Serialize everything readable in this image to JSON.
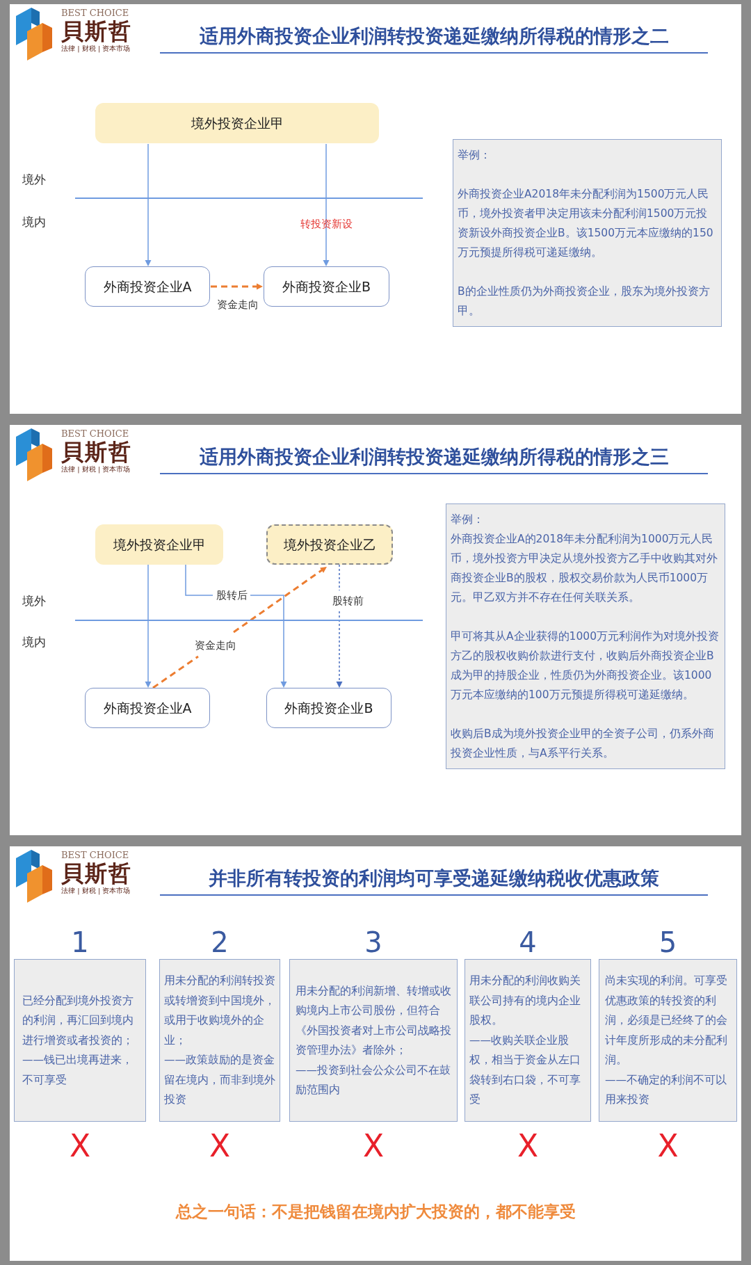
{
  "slides": [
    {
      "kind": "new-investment",
      "logo": {
        "tagline_en": "BEST CHOICE",
        "brand": "貝斯哲",
        "tagline_cn": "法律 | 财税 | 资本市场"
      },
      "title": "适用外商投资企业利润转投资递延缴纳所得税的情形之二",
      "diagram": {
        "nodes": [
          "境外投资企业甲",
          "外商投资企业A",
          "外商投资企业B"
        ],
        "zones": [
          "境外",
          "境内"
        ],
        "invest_label": "转投资新设",
        "flow_label": "资金走向"
      },
      "example": {
        "heading": "举例：",
        "paragraphs": [
          "外商投资企业A2018年未分配利润为1500万元人民币，境外投资者甲决定用该未分配利润1500万元投资新设外商投资企业B。该1500万元本应缴纳的150万元预提所得税可递延缴纳。",
          "B的企业性质仍为外商投资企业，股东为境外投资方甲。"
        ]
      }
    },
    {
      "kind": "acquisition",
      "logo": {
        "tagline_en": "BEST CHOICE",
        "brand": "貝斯哲",
        "tagline_cn": "法律 | 财税 | 资本市场"
      },
      "title": "适用外商投资企业利润转投资递延缴纳所得税的情形之三",
      "diagram": {
        "nodes": [
          "境外投资企业甲",
          "境外投资企业乙",
          "外商投资企业A",
          "外商投资企业B"
        ],
        "zones": [
          "境外",
          "境内"
        ],
        "after_label": "股转后",
        "before_label": "股转前",
        "flow_label": "资金走向"
      },
      "example": {
        "heading": "举例：",
        "paragraphs": [
          "外商投资企业A的2018年未分配利润为1000万元人民币，境外投资方甲决定从境外投资方乙手中收购其对外商投资企业B的股权，股权交易价款为人民币1000万元。甲乙双方并不存在任何关联关系。",
          "甲可将其从A企业获得的1000万元利润作为对境外投资方乙的股权收购价款进行支付，收购后外商投资企业B成为甲的持股企业，性质仍为外商投资企业。该1000万元本应缴纳的100万元预提所得税可递延缴纳。",
          "收购后B成为境外投资企业甲的全资子公司，仍系外商投资企业性质，与A系平行关系。"
        ]
      }
    },
    {
      "kind": "exclusions",
      "logo": {
        "tagline_en": "BEST CHOICE",
        "brand": "貝斯哲",
        "tagline_cn": "法律 | 财税 | 资本市场"
      },
      "title": "并非所有转投资的利润均可享受递延缴纳税收优惠政策",
      "columns": [
        {
          "number": "1",
          "text": "已经分配到境外投资方的利润，再汇回到境内进行增资或者投资的；",
          "note": "——钱已出境再进来，不可享受",
          "verdict": "X"
        },
        {
          "number": "2",
          "text": "用未分配的利润转投资或转增资到中国境外，或用于收购境外的企业；",
          "note": "——政策鼓励的是资金留在境内，而非到境外投资",
          "verdict": "X"
        },
        {
          "number": "3",
          "text": "用未分配的利润新增、转增或收购境内上市公司股份，但符合《外国投资者对上市公司战略投资管理办法》者除外；",
          "note": "——投资到社会公众公司不在鼓励范围内",
          "verdict": "X"
        },
        {
          "number": "4",
          "text": "用未分配的利润收购关联公司持有的境内企业股权。",
          "note": "——收购关联企业股权，相当于资金从左口袋转到右口袋，不可享受",
          "verdict": "X"
        },
        {
          "number": "5",
          "text": "尚未实现的利润。可享受优惠政策的转投资的利润，必须是已经终了的会计年度所形成的未分配利润。",
          "note": "——不确定的利润不可以用来投资",
          "verdict": "X"
        }
      ],
      "summary": "总之一句话：不是把钱留在境内扩大投资的，都不能享受"
    }
  ]
}
